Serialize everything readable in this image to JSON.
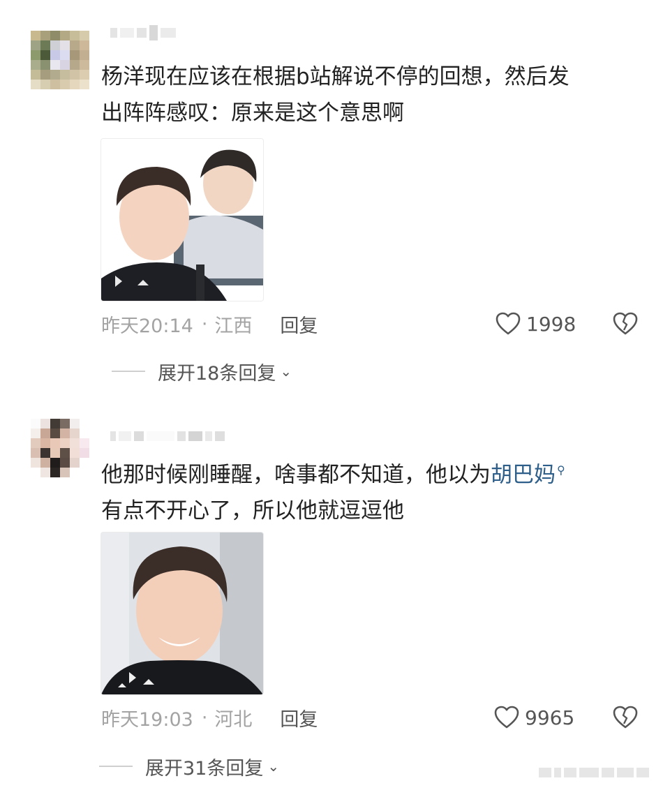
{
  "comments": [
    {
      "text": "杨洋现在应该在根据b站解说不停的回想，然后发\n出阵阵感叹：原来是这个意思啊",
      "time": "昨天20:14",
      "location": "江西",
      "reply_label": "回复",
      "likes": "1998",
      "expand_label": "展开18条回复"
    },
    {
      "text_before": "他那时候刚睡醒，啥事都不知道，他以为",
      "mention": "胡巴妈",
      "text_after": "有点不开心了，所以他就逗逗他",
      "time": "昨天19:03",
      "location": "河北",
      "reply_label": "回复",
      "likes": "9965",
      "expand_label": "展开31条回复"
    }
  ],
  "separator": "·",
  "icons": {
    "like": "heart-outline-icon",
    "dislike": "broken-heart-icon",
    "expand": "chevron-down-icon",
    "mention": "search-icon"
  },
  "colors": {
    "meta": "#a3a3a3",
    "mention": "#2e5f8a",
    "text": "#222222"
  }
}
